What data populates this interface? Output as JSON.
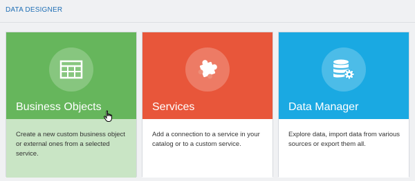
{
  "header": {
    "title": "DATA DESIGNER"
  },
  "cards": [
    {
      "title": "Business Objects",
      "description": "Create a new custom business object or external ones from a selected service.",
      "icon": "table-icon",
      "color": "#66b65c",
      "bottom_color": "#c9e5c5"
    },
    {
      "title": "Services",
      "description": "Add a connection to a service in your catalog or to a custom service.",
      "icon": "puzzle-icon",
      "color": "#e8563a",
      "bottom_color": "#ffffff"
    },
    {
      "title": "Data Manager",
      "description": "Explore data, import data from various sources or export them all.",
      "icon": "database-gear-icon",
      "color": "#1aa9e2",
      "bottom_color": "#ffffff"
    }
  ]
}
